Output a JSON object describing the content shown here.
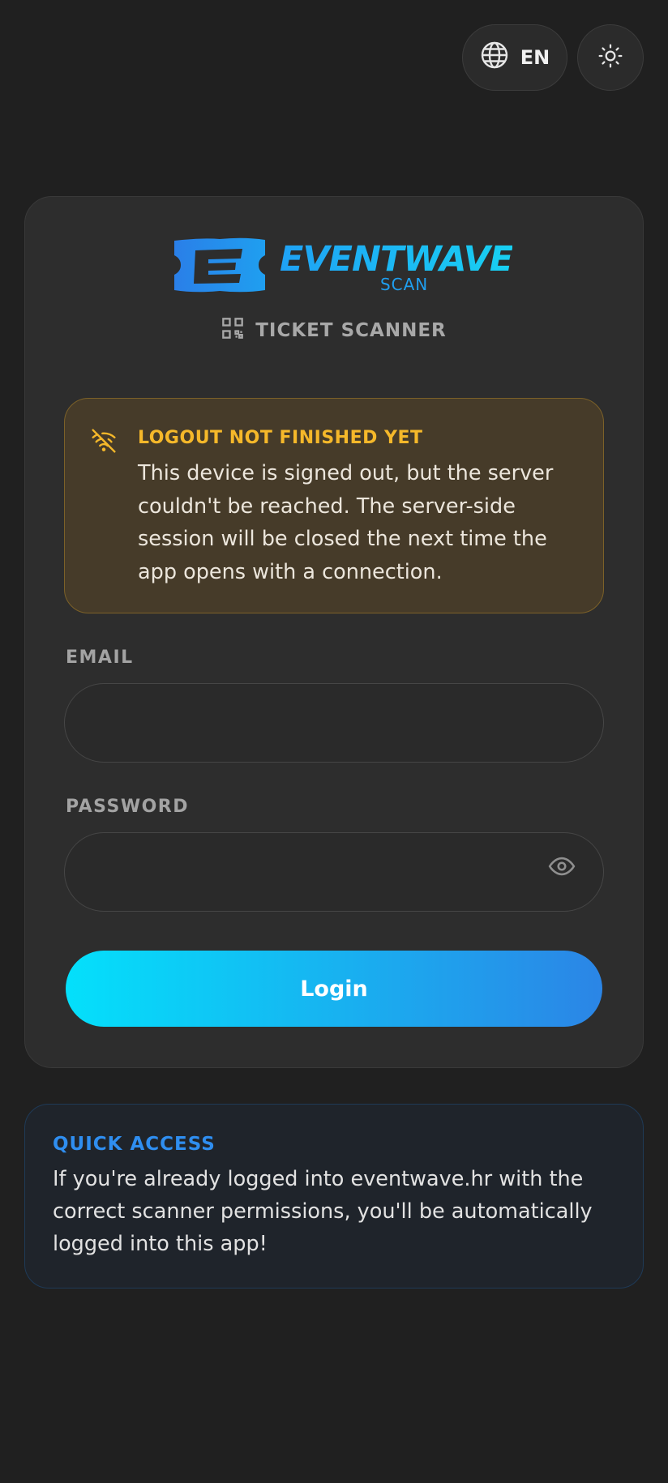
{
  "header": {
    "language_label": "EN",
    "language_icon": "globe-icon",
    "theme_icon": "sun-icon"
  },
  "brand": {
    "name": "EVENTWAVE",
    "sub": "SCAN",
    "logo_icon": "ticket-logo-icon",
    "colors": {
      "primary": "#1f9ff0",
      "accent": "#18d0f2"
    }
  },
  "login_card": {
    "subtitle": "TICKET SCANNER",
    "subtitle_icon": "qr-code-icon",
    "alert": {
      "icon": "wifi-off-icon",
      "title": "LOGOUT NOT FINISHED YET",
      "body": "This device is signed out, but the server couldn't be reached. The server-side session will be closed the next time the app opens with a connection.",
      "color": "#f5b82a"
    },
    "email": {
      "label": "EMAIL",
      "value": "",
      "placeholder": ""
    },
    "password": {
      "label": "PASSWORD",
      "value": "",
      "placeholder": "",
      "toggle_icon": "eye-icon"
    },
    "login_button": "Login"
  },
  "quick_access": {
    "title": "QUICK ACCESS",
    "body": "If you're already logged into eventwave.hr with the correct scanner permissions, you'll be automatically logged into this app!"
  }
}
